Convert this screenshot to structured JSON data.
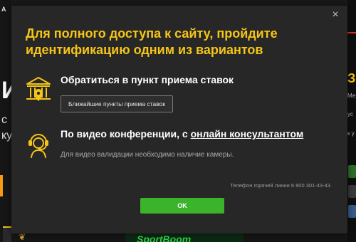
{
  "background": {
    "left_fragments": [
      "A",
      "И",
      "с",
      "ку"
    ],
    "right_fragments": [
      "З",
      "Ме",
      "ус",
      "к у"
    ],
    "bottom_brand": "SportBoom"
  },
  "modal": {
    "title": "Для полного доступа к сайту, пройдите идентификацию одним из вариантов",
    "close_glyph": "×",
    "option_office": {
      "title": "Обратиться в пункт приема ставок",
      "button_label": "Ближайшие пункты приема ставок",
      "icon": "bank-building-location-icon"
    },
    "option_video": {
      "title_prefix": "По видео конференции, с ",
      "title_link": "онлайн консультантом",
      "subtitle": "Для видео валидации необходимо наличие камеры.",
      "icon": "headset-operator-icon"
    },
    "hotline": "Телефон горячей линии 8 800 301-43-43.",
    "ok_label": "OK"
  },
  "colors": {
    "accent_yellow": "#f5c518",
    "ok_green": "#3bb32b",
    "modal_bg": "#272727"
  }
}
